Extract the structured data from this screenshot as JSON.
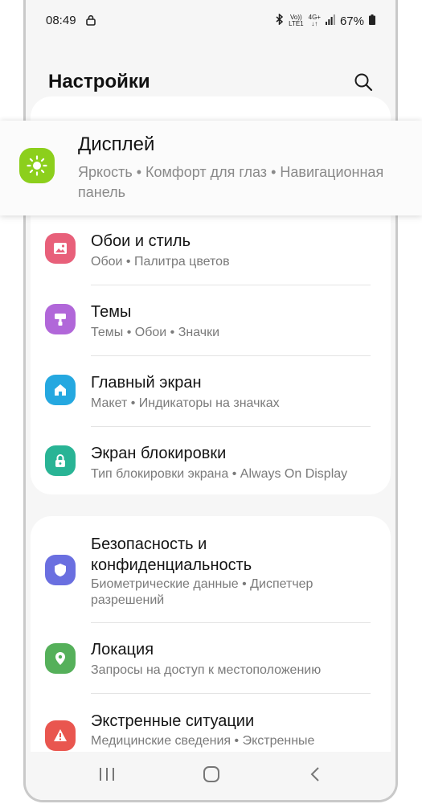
{
  "status": {
    "time": "08:49",
    "volte": "Vo))",
    "lte": "LTE1",
    "net": "4G+",
    "battery": "67%"
  },
  "header": {
    "title": "Настройки"
  },
  "highlight": {
    "label": "Дисплей",
    "sub": "Яркость  •  Комфорт для глаз  •  Навигационная панель"
  },
  "group1": [
    {
      "label": "Обои и стиль",
      "sub": "Обои  •  Палитра цветов",
      "color": "#e8607a"
    },
    {
      "label": "Темы",
      "sub": "Темы  •  Обои  •  Значки",
      "color": "#b167d9"
    },
    {
      "label": "Главный экран",
      "sub": "Макет  •  Индикаторы на значках",
      "color": "#25a8e0"
    },
    {
      "label": "Экран блокировки",
      "sub": "Тип блокировки экрана  •  Always On Display",
      "color": "#29b495"
    }
  ],
  "group2": [
    {
      "label": "Безопасность и конфиденциальность",
      "sub": "Биометрические данные  •  Диспетчер разрешений",
      "color": "#6a6fe0"
    },
    {
      "label": "Локация",
      "sub": "Запросы на доступ к местоположению",
      "color": "#55b05a"
    },
    {
      "label": "Экстренные ситуации",
      "sub": "Медицинские сведения  •  Экстренные",
      "color": "#e9564f"
    }
  ],
  "icons": {
    "search": "search-icon",
    "display": "sun-icon"
  }
}
